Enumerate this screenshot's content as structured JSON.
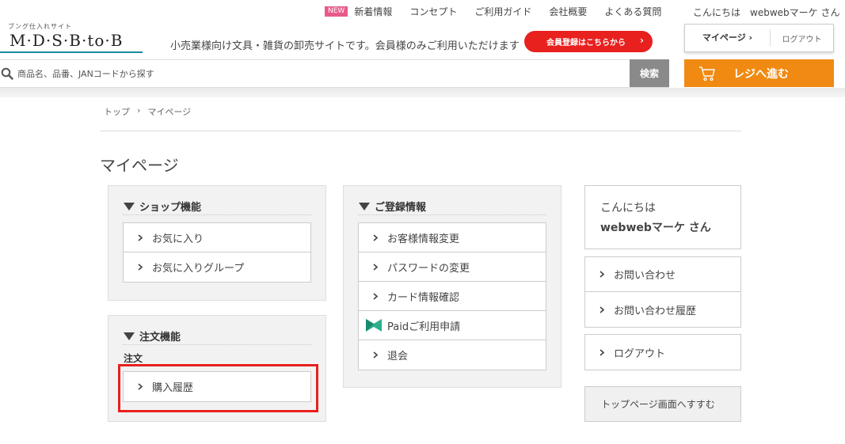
{
  "header": {
    "new_badge": "NEW",
    "nav": [
      "新着情報",
      "コンセプト",
      "ご利用ガイド",
      "会社概要",
      "よくある質問"
    ],
    "greeting": "こんにちは　webwebマーケ さん",
    "logo_sub": "ブング仕入れサイト",
    "logo_main": "M·D·S·B·to·B",
    "tagline": "小売業様向け文具・雑貨の卸売サイトです。会員様のみご利用いただけます",
    "register_label": "会員登録はこちらから",
    "mypage_label": "マイページ ›",
    "logout_label": "ログアウト",
    "search_placeholder": "商品名、品番、JANコードから探す",
    "search_button": "検索",
    "checkout_label": "レジへ進む",
    "colors": {
      "accent_red": "#e8201e",
      "checkout_orange": "#f08a12",
      "logo_teal": "#1a8aa0"
    }
  },
  "breadcrumb": {
    "home": "トップ",
    "separator": "›",
    "current": "マイページ"
  },
  "page_title": "マイページ",
  "shop_panel": {
    "heading": "ショップ機能",
    "items": [
      "お気に入り",
      "お気に入りグループ"
    ]
  },
  "order_panel": {
    "heading": "注文機能",
    "sub_label": "注文",
    "items": [
      "購入履歴"
    ]
  },
  "registration_panel": {
    "heading": "ご登録情報",
    "items": [
      {
        "label": "お客様情報変更",
        "icon": "chevron-right-icon"
      },
      {
        "label": "パスワードの変更",
        "icon": "chevron-right-icon"
      },
      {
        "label": "カード情報確認",
        "icon": "chevron-right-icon"
      },
      {
        "label": "Paidご利用申請",
        "icon": "paid-logo-icon"
      },
      {
        "label": "退会",
        "icon": "chevron-right-icon"
      }
    ]
  },
  "sidebar": {
    "greeting_line1": "こんにちは",
    "greeting_line2": "webwebマーケ さん",
    "contact_items": [
      "お問い合わせ",
      "お問い合わせ履歴"
    ],
    "logout_item": "ログアウト",
    "top_return": "トップページ画面へすすむ"
  }
}
